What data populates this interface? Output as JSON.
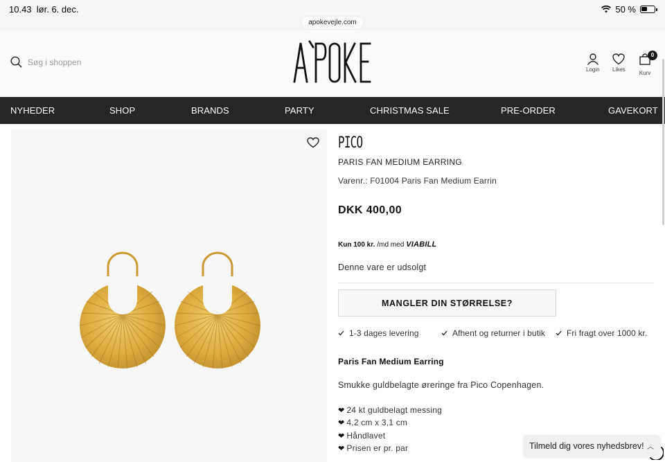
{
  "status_bar": {
    "time": "10.43",
    "date": "lør. 6. dec.",
    "battery": "50 %",
    "url": "apokevejle.com"
  },
  "header": {
    "search_placeholder": "Søg i shoppen",
    "logo_text": "A`POKE",
    "login_label": "Login",
    "likes_label": "Likes",
    "cart_label": "Kurv",
    "cart_count": "0"
  },
  "nav": {
    "items": [
      "NYHEDER",
      "SHOP",
      "BRANDS",
      "PARTY",
      "CHRISTMAS SALE",
      "PRE-ORDER",
      "GAVEKORT"
    ]
  },
  "product": {
    "brand": "PICO",
    "name": "PARIS FAN MEDIUM EARRING",
    "sku": "Varenr.: F01004 Paris Fan Medium Earrin",
    "price": "DKK 400,00",
    "viabill_amount": "Kun 100 kr.",
    "viabill_suffix": "/md med",
    "viabill_logo": "VIABILL",
    "stock_status": "Denne vare er udsolgt",
    "size_button": "MANGLER DIN STØRRELSE?",
    "usps": [
      "1-3 dages levering",
      "Afhent og returner i butik",
      "Fri fragt over 1000 kr."
    ],
    "description_title": "Paris Fan Medium Earring",
    "description": "Smukke guldbelagte øreringe fra Pico Copenhagen.",
    "features": [
      "24 kt guldbelagt messing",
      "4,2 cm x 3,1 cm",
      "Håndlavet",
      "Prisen er pr. par"
    ]
  },
  "newsletter": {
    "label": "Tilmeld dig vores nyhedsbrev!"
  },
  "colors": {
    "nav_bg": "#262626",
    "gold": "#d8a93c"
  }
}
